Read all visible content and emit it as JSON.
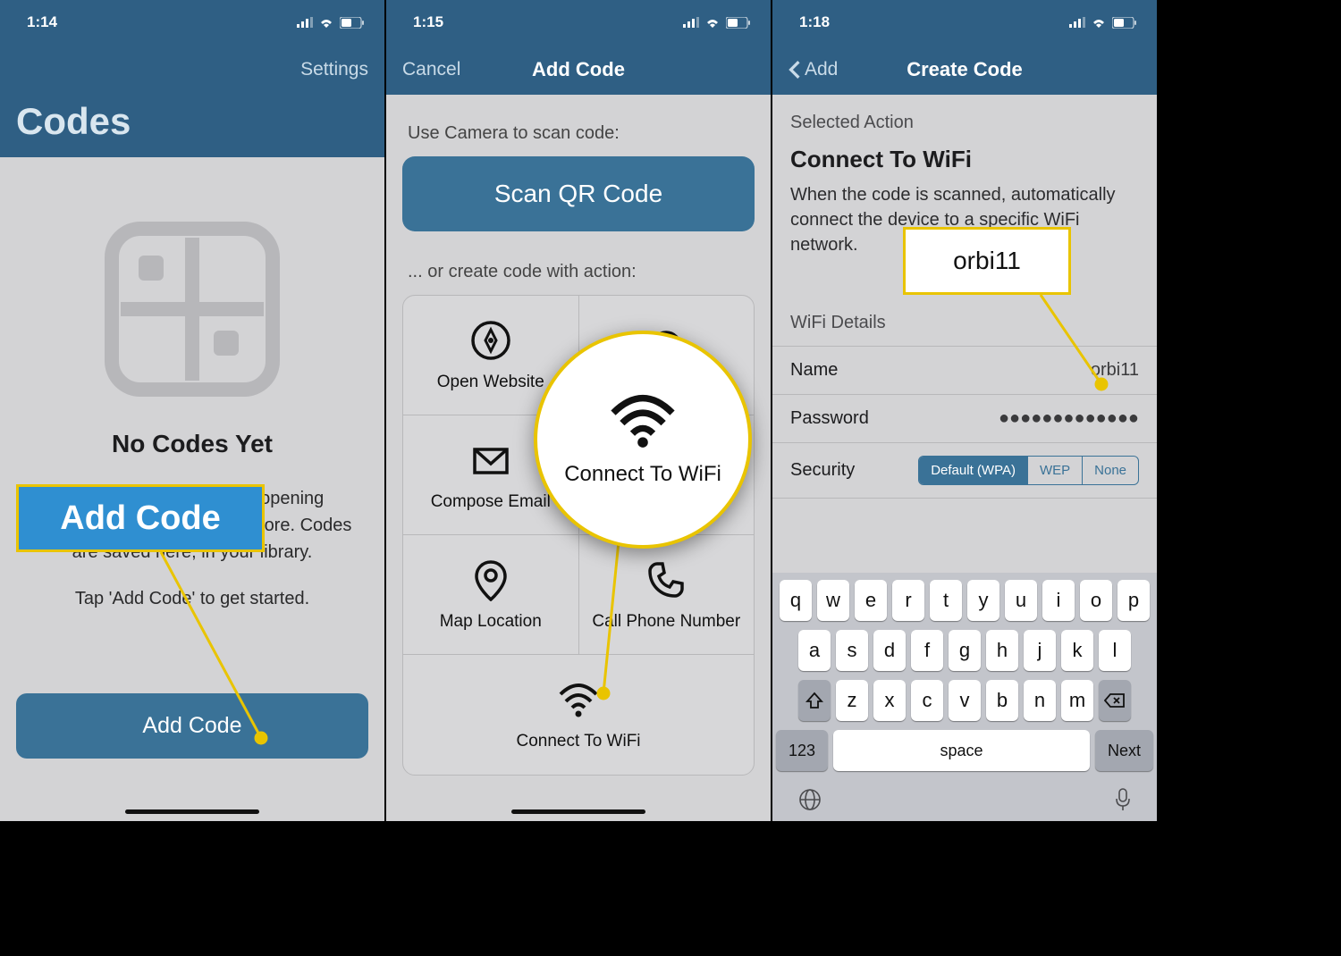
{
  "screen1": {
    "time": "1:14",
    "settings": "Settings",
    "title": "Codes",
    "empty_heading": "No Codes Yet",
    "empty_line1": "Scan or create codes for opening websites, joining WiFi, and more. Codes are saved here, in your library.",
    "empty_line2": "Tap 'Add Code' to get started.",
    "add_button": "Add Code",
    "highlight_add": "Add Code"
  },
  "screen2": {
    "time": "1:15",
    "cancel": "Cancel",
    "title": "Add Code",
    "scan_prompt": "Use Camera to scan code:",
    "scan_button": "Scan QR Code",
    "or_prompt": "... or create code with action:",
    "actions": {
      "open_website": "Open Website",
      "compose_email": "Compose Email",
      "map_location": "Map Location",
      "call_phone": "Call Phone Number",
      "connect_wifi": "Connect To WiFi"
    },
    "bubble_text": "Connect To WiFi"
  },
  "screen3": {
    "time": "1:18",
    "back": "Add",
    "title": "Create Code",
    "selected_action_hdr": "Selected Action",
    "action_title": "Connect To WiFi",
    "desc": "When the code is scanned, automatically connect the device to a specific WiFi network.",
    "highlight_value": "orbi11",
    "details_hdr": "WiFi Details",
    "name_label": "Name",
    "name_value": "orbi11",
    "password_label": "Password",
    "password_value": "●●●●●●●●●●●●●",
    "security_label": "Security",
    "sec_default": "Default (WPA)",
    "sec_wep": "WEP",
    "sec_none": "None",
    "kbd": {
      "row1": [
        "q",
        "w",
        "e",
        "r",
        "t",
        "y",
        "u",
        "i",
        "o",
        "p"
      ],
      "row2": [
        "a",
        "s",
        "d",
        "f",
        "g",
        "h",
        "j",
        "k",
        "l"
      ],
      "row3": [
        "z",
        "x",
        "c",
        "v",
        "b",
        "n",
        "m"
      ],
      "num": "123",
      "space": "space",
      "next": "Next"
    }
  }
}
